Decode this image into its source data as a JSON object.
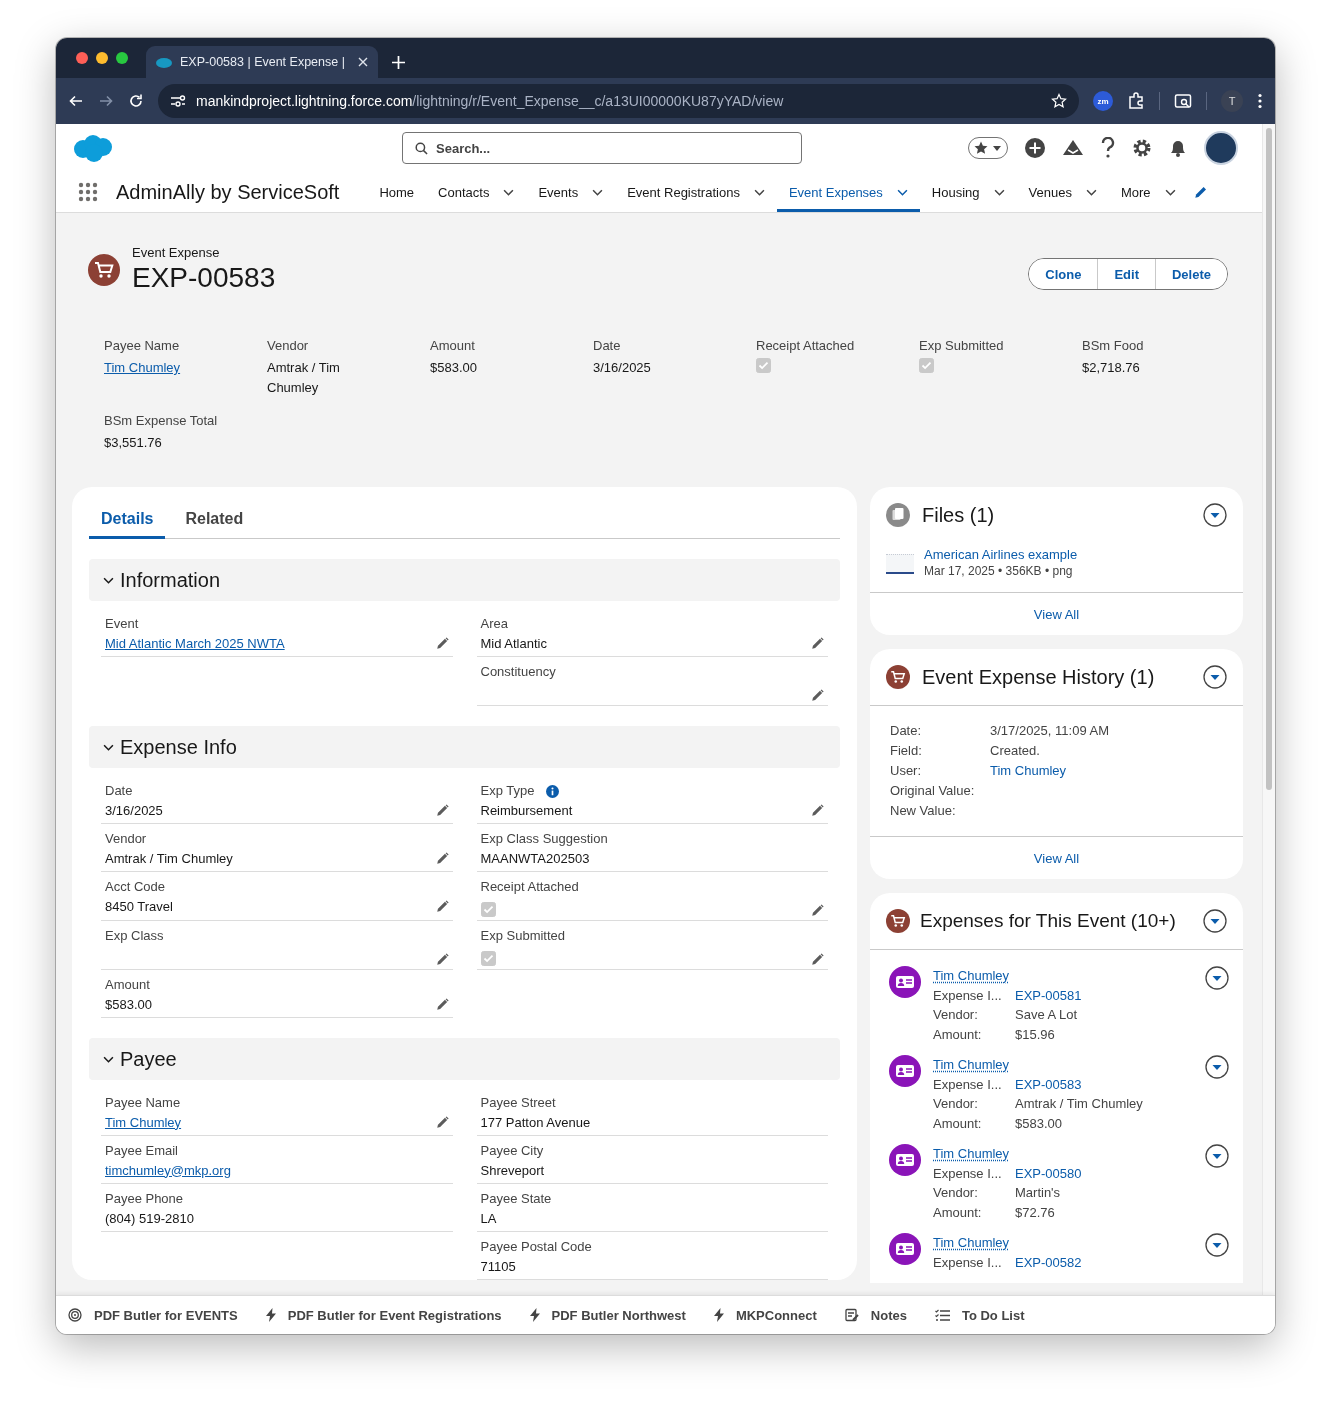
{
  "browser": {
    "tab_title": "EXP-00583 | Event Expense |",
    "url_host": "mankindproject.lightning.force.com",
    "url_path": "/lightning/r/Event_Expense__c/a13UI00000KU87yYAD/view",
    "extension_label": "zm",
    "profile_initial": "T"
  },
  "header": {
    "search": {
      "placeholder": "Search..."
    },
    "app_name": "AdminAlly by ServiceSoft",
    "nav": [
      {
        "label": "Home",
        "selected": false,
        "menu": false
      },
      {
        "label": "Contacts",
        "selected": false,
        "menu": true
      },
      {
        "label": "Events",
        "selected": false,
        "menu": true
      },
      {
        "label": "Event Registrations",
        "selected": false,
        "menu": true
      },
      {
        "label": "Event Expenses",
        "selected": true,
        "menu": true
      },
      {
        "label": "Housing",
        "selected": false,
        "menu": true
      },
      {
        "label": "Venues",
        "selected": false,
        "menu": true
      },
      {
        "label": "More",
        "selected": false,
        "menu": true
      }
    ]
  },
  "record": {
    "object_label": "Event Expense",
    "title": "EXP-00583",
    "actions": [
      "Clone",
      "Edit",
      "Delete"
    ]
  },
  "highlights": [
    {
      "label": "Payee Name",
      "kind": "link",
      "value": "Tim Chumley"
    },
    {
      "label": "Vendor",
      "kind": "text",
      "value": "Amtrak / Tim Chumley"
    },
    {
      "label": "Amount",
      "kind": "text",
      "value": "$583.00"
    },
    {
      "label": "Date",
      "kind": "text",
      "value": "3/16/2025"
    },
    {
      "label": "Receipt Attached",
      "kind": "checkbox",
      "checked": true
    },
    {
      "label": "Exp Submitted",
      "kind": "checkbox",
      "checked": true
    },
    {
      "label": "BSm Food",
      "kind": "text",
      "value": "$2,718.76"
    },
    {
      "label": "BSm Expense Total",
      "kind": "text",
      "value": "$3,551.76"
    }
  ],
  "detail_tabs": [
    {
      "label": "Details",
      "selected": true
    },
    {
      "label": "Related",
      "selected": false
    }
  ],
  "sections": [
    {
      "title": "Information",
      "expanded": true,
      "fields": [
        {
          "label": "Event",
          "kind": "link",
          "value": "Mid Atlantic March 2025 NWTA",
          "editable": true
        },
        {
          "label": "Area",
          "kind": "text",
          "value": "Mid Atlantic",
          "editable": true
        },
        {
          "kind": "blank"
        },
        {
          "label": "Constituency",
          "kind": "text",
          "editable": true
        }
      ]
    },
    {
      "title": "Expense Info",
      "expanded": true,
      "fields": [
        {
          "label": "Date",
          "kind": "text",
          "value": "3/16/2025",
          "editable": true
        },
        {
          "label": "Exp Type",
          "kind": "text",
          "value": "Reimbursement",
          "editable": true,
          "help": true
        },
        {
          "label": "Vendor",
          "kind": "text",
          "value": "Amtrak / Tim Chumley",
          "editable": true
        },
        {
          "label": "Exp Class Suggestion",
          "kind": "text",
          "value": "MAANWTA202503",
          "editable": false
        },
        {
          "label": "Acct Code",
          "kind": "text",
          "value": "8450 Travel",
          "editable": true
        },
        {
          "label": "Receipt Attached",
          "kind": "checkbox",
          "checked": true,
          "editable": true
        },
        {
          "label": "Exp Class",
          "kind": "text",
          "editable": true
        },
        {
          "label": "Exp Submitted",
          "kind": "checkbox",
          "checked": true,
          "editable": true
        },
        {
          "label": "Amount",
          "kind": "text",
          "value": "$583.00",
          "editable": true
        }
      ]
    },
    {
      "title": "Payee",
      "expanded": true,
      "fields": [
        {
          "label": "Payee Name",
          "kind": "link",
          "value": "Tim Chumley",
          "editable": true
        },
        {
          "label": "Payee Street",
          "kind": "text",
          "value": "177 Patton Avenue",
          "editable": false
        },
        {
          "label": "Payee Email",
          "kind": "link",
          "value": "timchumley@mkp.org",
          "editable": false
        },
        {
          "label": "Payee City",
          "kind": "text",
          "value": "Shreveport",
          "editable": false
        },
        {
          "label": "Payee Phone",
          "kind": "text",
          "value": "(804) 519-2810",
          "editable": false
        },
        {
          "label": "Payee State",
          "kind": "text",
          "value": "LA",
          "editable": false
        },
        {
          "kind": "blank"
        },
        {
          "label": "Payee Postal Code",
          "kind": "text",
          "value": "71105",
          "editable": false
        }
      ]
    }
  ],
  "files": {
    "title": "Files (1)",
    "items": [
      {
        "name": "American Airlines example",
        "meta": "Mar 17, 2025 • 356KB • png"
      }
    ],
    "view_all": "View All"
  },
  "history": {
    "title": "Event Expense History (1)",
    "entries": [
      {
        "label": "Date:",
        "kind": "text",
        "value": "3/17/2025, 11:09 AM"
      },
      {
        "label": "Field:",
        "kind": "text",
        "value": "Created."
      },
      {
        "label": "User:",
        "kind": "link",
        "value": "Tim Chumley"
      },
      {
        "label": "Original Value:"
      },
      {
        "label": "New Value:"
      }
    ],
    "view_all": "View All"
  },
  "expenses": {
    "title": "Expenses for This Event (10+)",
    "items": [
      {
        "name": "Tim Chumley",
        "rows": [
          {
            "label": "Expense I...",
            "kind": "link",
            "value": "EXP-00581"
          },
          {
            "label": "Vendor:",
            "kind": "text",
            "value": "Save A Lot"
          },
          {
            "label": "Amount:",
            "kind": "text",
            "value": "$15.96"
          }
        ]
      },
      {
        "name": "Tim Chumley",
        "rows": [
          {
            "label": "Expense I...",
            "kind": "link",
            "value": "EXP-00583"
          },
          {
            "label": "Vendor:",
            "kind": "text",
            "value": "Amtrak / Tim Chumley"
          },
          {
            "label": "Amount:",
            "kind": "text",
            "value": "$583.00"
          }
        ]
      },
      {
        "name": "Tim Chumley",
        "rows": [
          {
            "label": "Expense I...",
            "kind": "link",
            "value": "EXP-00580"
          },
          {
            "label": "Vendor:",
            "kind": "text",
            "value": "Martin's"
          },
          {
            "label": "Amount:",
            "kind": "text",
            "value": "$72.76"
          }
        ]
      },
      {
        "name": "Tim Chumley",
        "rows": [
          {
            "label": "Expense I...",
            "kind": "link",
            "value": "EXP-00582"
          }
        ]
      }
    ]
  },
  "utility_bar": [
    {
      "label": "PDF Butler for EVENTS",
      "kind": "target"
    },
    {
      "label": "PDF Butler for Event Registrations",
      "kind": "bolt"
    },
    {
      "label": "PDF Butler Northwest",
      "kind": "bolt"
    },
    {
      "label": "MKPConnect",
      "kind": "bolt"
    },
    {
      "label": "Notes",
      "kind": "notes"
    },
    {
      "label": "To Do List",
      "kind": "checklist"
    }
  ]
}
